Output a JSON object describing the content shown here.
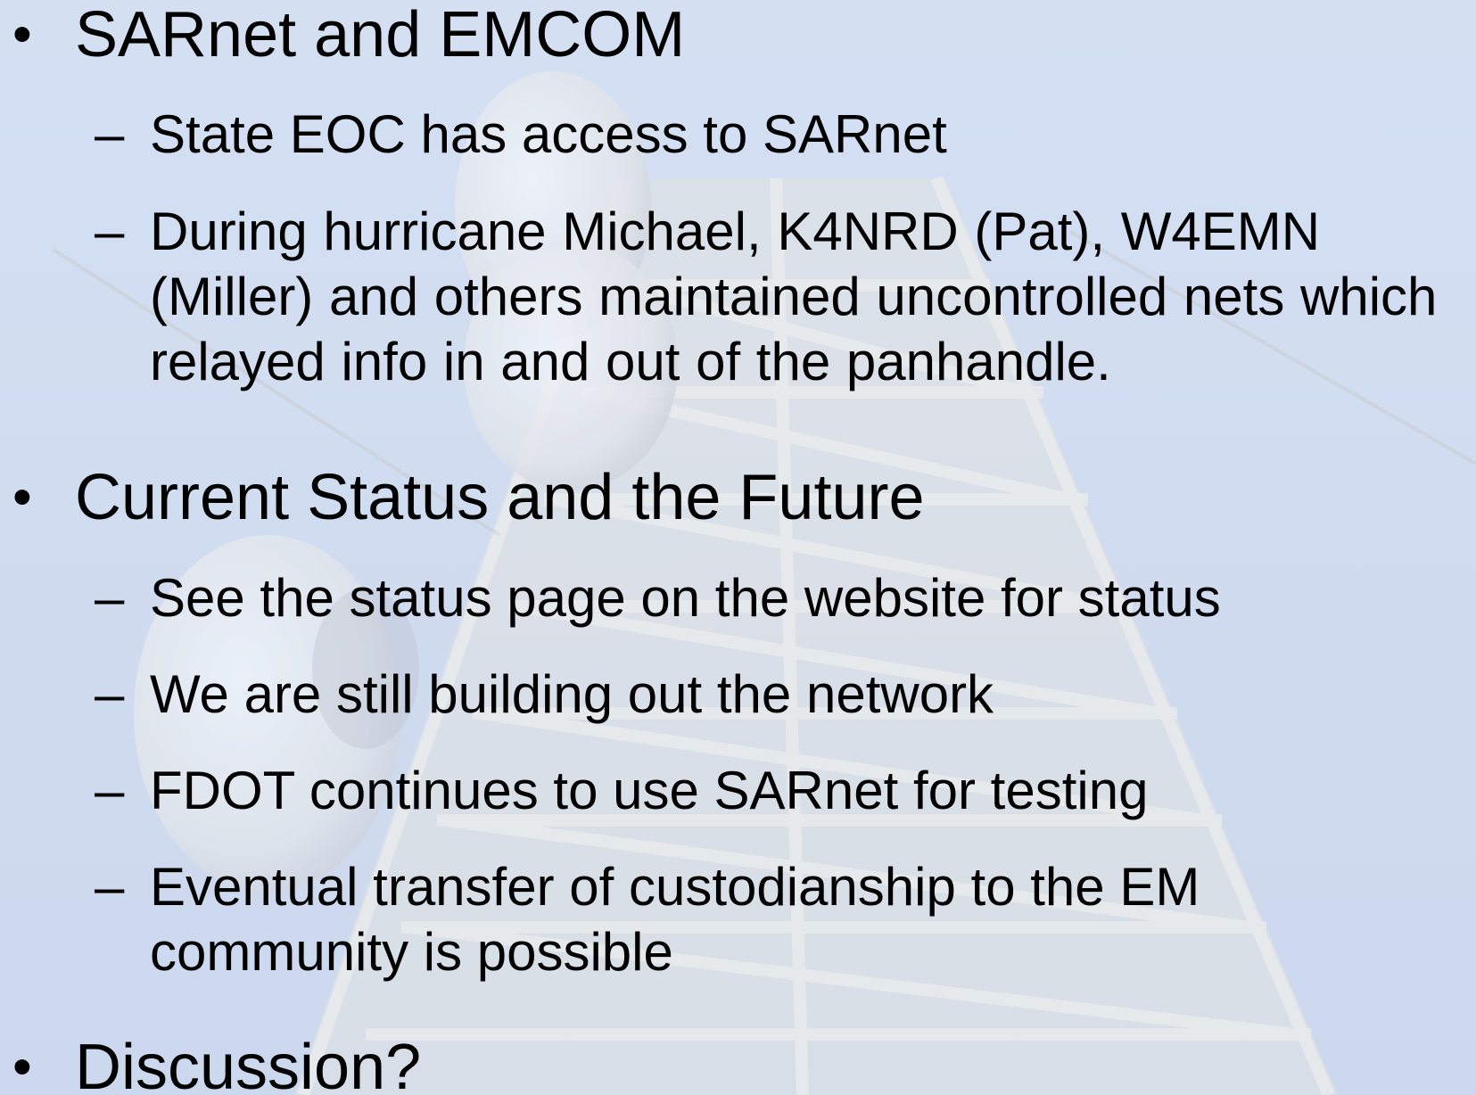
{
  "slide": {
    "sections": [
      {
        "heading": "SARnet and EMCOM",
        "items": [
          "State EOC has access to SARnet",
          "During hurricane Michael, K4NRD (Pat),  W4EMN (Miller) and others maintained uncontrolled nets which relayed info in and out of the panhandle."
        ]
      },
      {
        "heading": "Current Status and the Future",
        "items": [
          "See the status page on the website for status",
          "We are still building out the network",
          "FDOT continues to use SARnet for testing",
          "Eventual transfer of custodianship to the EM community is possible"
        ]
      },
      {
        "heading": "Discussion?",
        "items": []
      }
    ]
  },
  "glyphs": {
    "bullet": "•",
    "dash": "–"
  },
  "colors": {
    "background": "#cdd9ee",
    "text": "#000000",
    "tower": "#f4f1ea"
  }
}
